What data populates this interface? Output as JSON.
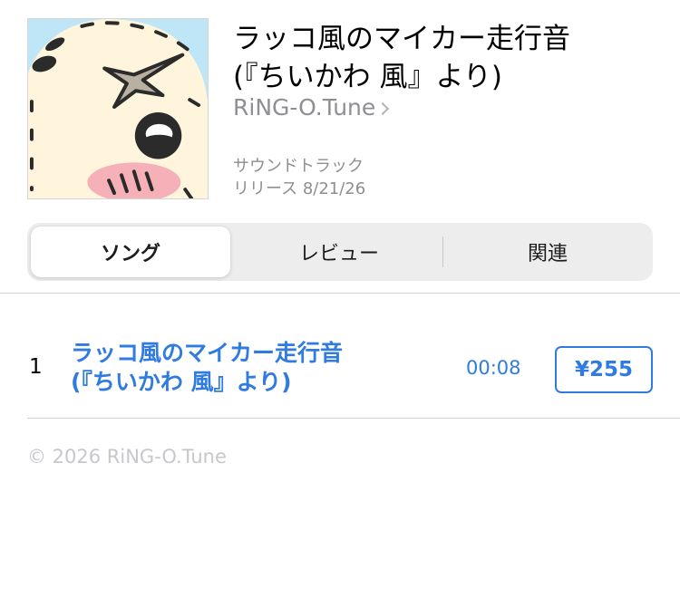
{
  "album": {
    "title": "ラッコ風のマイカー走行音\n(『ちいかわ 風』より)",
    "artist": "RiNG-O.Tune",
    "genre": "サウンドトラック",
    "release": "リリース 8/21/26"
  },
  "tabs": {
    "songs": "ソング",
    "reviews": "レビュー",
    "related": "関連",
    "selected": "songs"
  },
  "tracks": [
    {
      "number": "1",
      "title": "ラッコ風のマイカー走行音\n(『ちいかわ 風』より)",
      "duration": "00:08",
      "price": "¥255"
    }
  ],
  "footer": {
    "copyright": "© 2026 RiNG-O.Tune"
  },
  "colors": {
    "accent": "#2f7be0",
    "secondary_text": "#8e8e93",
    "segment_background": "#ededed"
  },
  "icons": {
    "artist_chevron": "chevron-right-icon"
  }
}
